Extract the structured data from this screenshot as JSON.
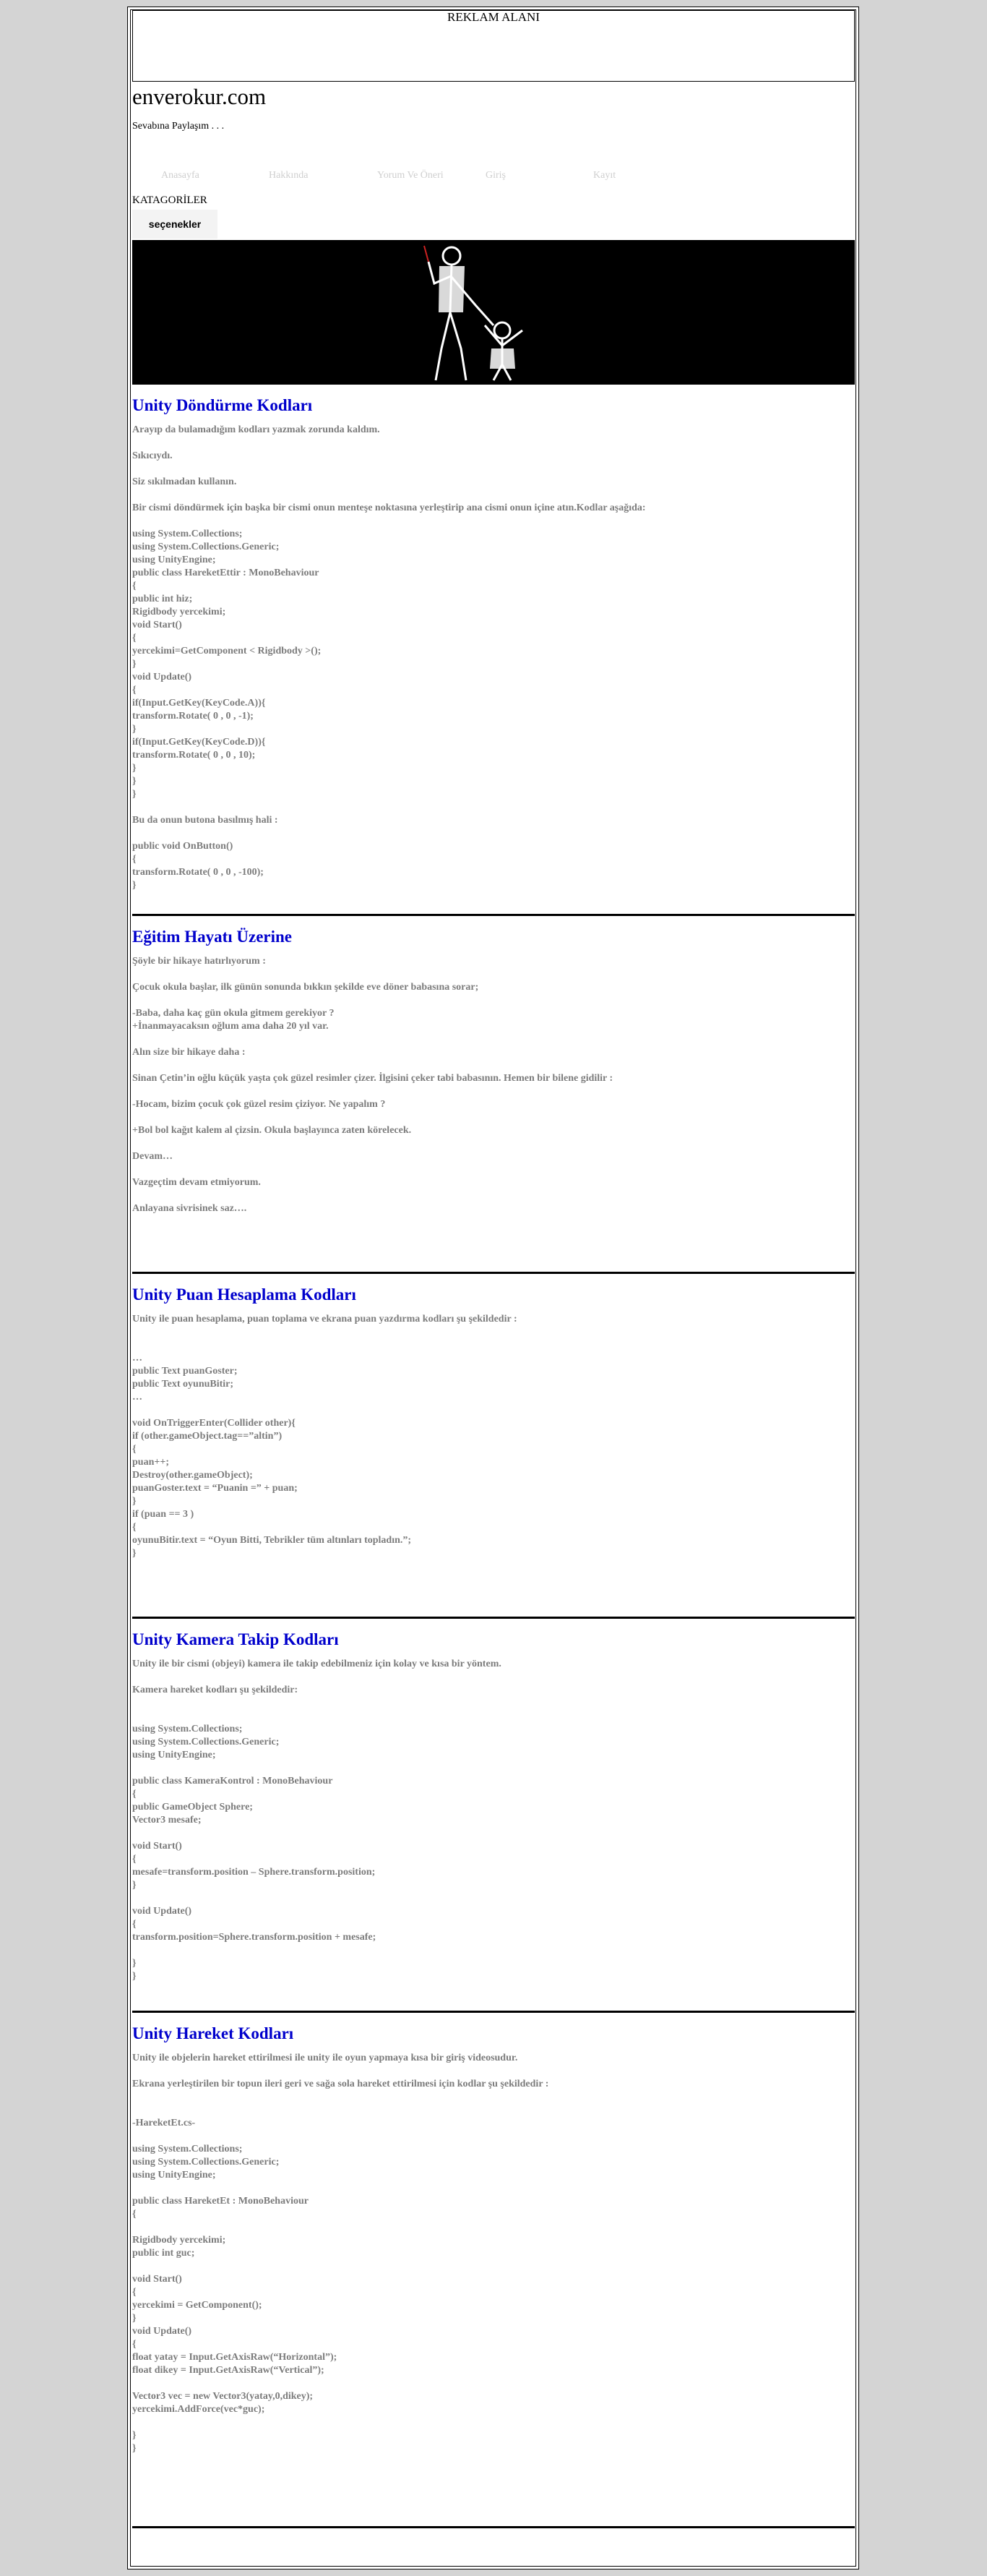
{
  "ad": {
    "label": "REKLAM ALANI"
  },
  "site": {
    "title": "enverokur.com",
    "slogan": "Sevabına Paylaşım . . ."
  },
  "nav": [
    {
      "label": "Anasayfa"
    },
    {
      "label": "Hakkında"
    },
    {
      "label": "Yorum Ve Öneri"
    },
    {
      "label": "Giriş"
    },
    {
      "label": "Kayıt"
    }
  ],
  "categories": {
    "heading": "KATAGORİLER",
    "options_label": "seçenekler"
  },
  "posts": [
    {
      "title": "Unity Döndürme Kodları",
      "blocks": [
        {
          "type": "p",
          "text": "Arayıp da bulamadığım kodları yazmak zorunda kaldım."
        },
        {
          "type": "p",
          "text": "Sıkıcıydı."
        },
        {
          "type": "p",
          "text": "Siz sıkılmadan kullanın."
        },
        {
          "type": "p",
          "text": "Bir cismi döndürmek için başka bir cismi onun menteşe noktasına yerleştirip ana cismi onun içine atın.Kodlar aşağıda:"
        },
        {
          "type": "code",
          "text": "using System.Collections;\nusing System.Collections.Generic;\nusing UnityEngine;\npublic class HareketEttir : MonoBehaviour\n{\npublic int hiz;\nRigidbody yercekimi;\nvoid Start()\n{\nyercekimi=GetComponent < Rigidbody >();\n}\nvoid Update()\n{\nif(Input.GetKey(KeyCode.A)){\ntransform.Rotate( 0 , 0 , -1);\n}\nif(Input.GetKey(KeyCode.D)){\ntransform.Rotate( 0 , 0 , 10);\n}\n}\n}"
        },
        {
          "type": "p",
          "text": "Bu da onun butona basılmış hali :"
        },
        {
          "type": "code",
          "text": "public void OnButton()\n{\ntransform.Rotate( 0 , 0 , -100);\n}"
        }
      ]
    },
    {
      "title": "Eğitim Hayatı Üzerine",
      "blocks": [
        {
          "type": "p",
          "text": "Şöyle bir hikaye hatırlıyorum :"
        },
        {
          "type": "p",
          "text": "Çocuk okula başlar, ilk günün sonunda bıkkın şekilde eve döner babasına sorar;"
        },
        {
          "type": "code",
          "text": "-Baba, daha kaç gün okula gitmem gerekiyor ?\n+İnanmayacaksın oğlum ama daha 20 yıl var."
        },
        {
          "type": "p",
          "text": "Alın size bir hikaye daha :"
        },
        {
          "type": "p",
          "text": "Sinan Çetin’in oğlu küçük yaşta çok güzel resimler çizer. İlgisini çeker tabi babasının. Hemen bir bilene gidilir :"
        },
        {
          "type": "p",
          "text": "-Hocam, bizim çocuk çok güzel resim çiziyor. Ne yapalım ?"
        },
        {
          "type": "p",
          "text": "+Bol bol kağıt kalem al çizsin. Okula başlayınca zaten körelecek."
        },
        {
          "type": "p",
          "text": "Devam…"
        },
        {
          "type": "p",
          "text": "Vazgeçtim devam etmiyorum."
        },
        {
          "type": "p",
          "text": "Anlayana sivrisinek saz…."
        }
      ]
    },
    {
      "title": "Unity Puan Hesaplama Kodları",
      "blocks": [
        {
          "type": "p",
          "text": "Unity ile puan hesaplama, puan toplama ve ekrana puan yazdırma kodları şu şekildedir :"
        },
        {
          "type": "code",
          "text": "\n…\npublic Text puanGoster;\npublic Text oyunuBitir;\n…\n\nvoid OnTriggerEnter(Collider other){\nif (other.gameObject.tag==”altin”)\n{\npuan++;\nDestroy(other.gameObject);\npuanGoster.text = “Puanin =” + puan;\n}\nif (puan == 3 )\n{\noyunuBitir.text = “Oyun Bitti, Tebrikler tüm altınları topladın.”;\n}"
        }
      ]
    },
    {
      "title": "Unity Kamera Takip Kodları",
      "blocks": [
        {
          "type": "p",
          "text": "Unity ile bir cismi (objeyi) kamera ile takip edebilmeniz için kolay ve kısa bir yöntem."
        },
        {
          "type": "p",
          "text": "Kamera hareket kodları şu şekildedir:"
        },
        {
          "type": "code",
          "text": "\nusing System.Collections;\nusing System.Collections.Generic;\nusing UnityEngine;\n\npublic class KameraKontrol : MonoBehaviour\n{\npublic GameObject Sphere;\nVector3 mesafe;\n\nvoid Start()\n{\nmesafe=transform.position – Sphere.transform.position;\n}\n\nvoid Update()\n{\ntransform.position=Sphere.transform.position + mesafe;\n\n}\n}"
        }
      ]
    },
    {
      "title": "Unity Hareket Kodları",
      "blocks": [
        {
          "type": "p",
          "text": "Unity ile objelerin hareket ettirilmesi ile unity ile oyun yapmaya kısa bir giriş videosudur."
        },
        {
          "type": "p",
          "text": "Ekrana yerleştirilen bir topun ileri geri ve sağa sola hareket ettirilmesi için kodlar şu şekildedir :"
        },
        {
          "type": "code",
          "text": "\n-HareketEt.cs-\n\nusing System.Collections;\nusing System.Collections.Generic;\nusing UnityEngine;\n\npublic class HareketEt : MonoBehaviour\n{\n\nRigidbody yercekimi;\npublic int guc;\n\nvoid Start()\n{\nyercekimi = GetComponent();\n}\nvoid Update()\n{\nfloat yatay = Input.GetAxisRaw(“Horizontal”);\nfloat dikey = Input.GetAxisRaw(“Vertical”);\n\nVector3 vec = new Vector3(yatay,0,dikey);\nyercekimi.AddForce(vec*guc);\n\n}\n}"
        }
      ]
    }
  ]
}
